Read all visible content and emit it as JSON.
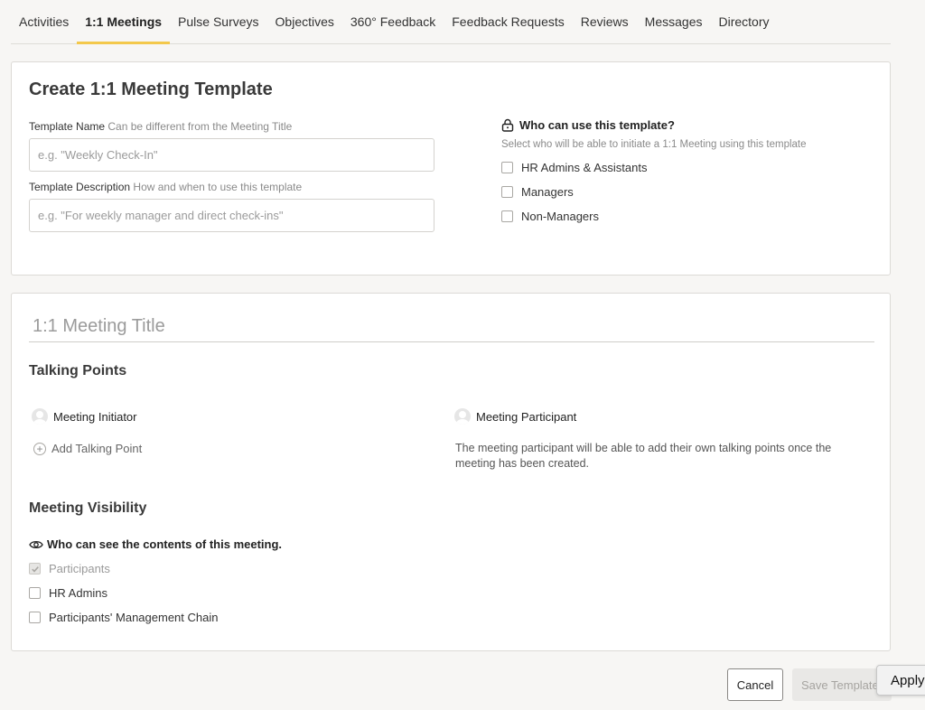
{
  "nav": {
    "tabs": [
      {
        "label": "Activities"
      },
      {
        "label": "1:1 Meetings",
        "active": true
      },
      {
        "label": "Pulse Surveys"
      },
      {
        "label": "Objectives"
      },
      {
        "label": "360° Feedback"
      },
      {
        "label": "Feedback Requests"
      },
      {
        "label": "Reviews"
      },
      {
        "label": "Messages"
      },
      {
        "label": "Directory"
      }
    ],
    "accent_color": "#f3c84b"
  },
  "template": {
    "page_title": "Create 1:1 Meeting Template",
    "name_label": "Template Name",
    "name_hint": "Can be different from the Meeting Title",
    "name_placeholder": "e.g. \"Weekly Check-In\"",
    "name_value": "",
    "desc_label": "Template Description",
    "desc_hint": "How and when to use this template",
    "desc_placeholder": "e.g. \"For weekly manager and direct check-ins\"",
    "desc_value": ""
  },
  "permissions": {
    "heading": "Who can use this template?",
    "subtext": "Select who will be able to initiate a 1:1 Meeting using this template",
    "options": [
      {
        "label": "HR Admins & Assistants",
        "checked": false
      },
      {
        "label": "Managers",
        "checked": false
      },
      {
        "label": "Non-Managers",
        "checked": false
      }
    ]
  },
  "meeting": {
    "title_placeholder": "1:1 Meeting Title",
    "talking_points_heading": "Talking Points",
    "initiator_label": "Meeting Initiator",
    "participant_label": "Meeting Participant",
    "add_talking_point": "Add Talking Point",
    "participant_note": "The meeting participant will be able to add their own talking points once the meeting has been created.",
    "visibility_heading": "Meeting Visibility",
    "visibility_question": "Who can see the contents of this meeting.",
    "visibility_options": [
      {
        "label": "Participants",
        "checked": true,
        "disabled": true
      },
      {
        "label": "HR Admins",
        "checked": false
      },
      {
        "label": "Participants' Management Chain",
        "checked": false
      }
    ]
  },
  "footer": {
    "cancel_label": "Cancel",
    "save_label": "Save Template",
    "apply_label": "Apply"
  }
}
